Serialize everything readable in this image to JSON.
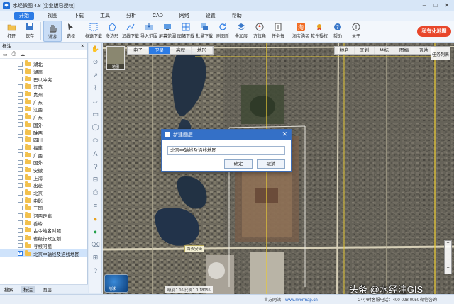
{
  "app": {
    "title": "水经微图 4.8 [企业版已授权]",
    "window_controls": [
      "–",
      "□",
      "✕"
    ]
  },
  "menu": {
    "items": [
      "开始",
      "视图",
      "下载",
      "工具",
      "分析",
      "CAD",
      "网络",
      "设置",
      "帮助"
    ],
    "active": "开始"
  },
  "toolbar": {
    "items": [
      {
        "label": "打开",
        "icon": "folder-open-icon"
      },
      {
        "label": "保存",
        "icon": "save-icon"
      },
      {
        "label": "漫游",
        "icon": "hand-icon"
      },
      {
        "label": "选择",
        "icon": "cursor-icon"
      },
      {
        "label": "框选下载",
        "icon": "frame-select-icon"
      },
      {
        "label": "多边形",
        "icon": "polygon-icon"
      },
      {
        "label": "沿线下载",
        "icon": "polyline-icon"
      },
      {
        "label": "导入范围",
        "icon": "import-icon"
      },
      {
        "label": "屏幕范围",
        "icon": "screen-icon"
      },
      {
        "label": "图幅下载",
        "icon": "grid-icon"
      },
      {
        "label": "批量下载",
        "icon": "batch-icon"
      },
      {
        "label": "刷图新",
        "icon": "refresh-icon"
      },
      {
        "label": "叠加层",
        "icon": "layers-icon"
      },
      {
        "label": "方位角",
        "icon": "compass-icon"
      },
      {
        "label": "任务每",
        "icon": "task-icon"
      },
      {
        "label": "淘宝购买",
        "icon": "taobao-icon"
      },
      {
        "label": "软件授权",
        "icon": "license-icon"
      },
      {
        "label": "帮助",
        "icon": "help-icon"
      },
      {
        "label": "关于",
        "icon": "info-icon"
      }
    ],
    "active": "漫游",
    "private_button": "私有化地图"
  },
  "left_panel": {
    "title": "标注",
    "close": "✕",
    "tree": [
      "湖北",
      "湖南",
      "巴以冲突",
      "江苏",
      "贵州",
      "广东",
      "江西",
      "广东",
      "国外",
      "陕西",
      "四川",
      "福建",
      "广西",
      "国外",
      "安徽",
      "上海",
      "出差",
      "北京",
      "电影",
      "三国",
      "河西走廊",
      "香岭",
      "古今地名对照",
      "省级行政区划",
      "寻根问祖",
      "北京中轴线及沿线地图"
    ],
    "selected": "北京中轴线及沿线地图",
    "tabs": [
      "搜索",
      "标注",
      "图层"
    ],
    "active_tab": "标注"
  },
  "map": {
    "base_tabs": [
      "电子",
      "卫星",
      "高程",
      "地形"
    ],
    "active_base_tab": "卫星",
    "overlay_tabs": [
      "地名",
      "区划",
      "坐标",
      "图幅",
      "瓦片"
    ],
    "thumbnail_label": "地图",
    "task_list": "任务列表",
    "labels": [
      "西长安街",
      "北京中轴线"
    ],
    "road_tags": [
      "西长安街"
    ],
    "globe_label": "地球",
    "scale": "级别：16  比例：1:18055",
    "zoom_plus": "+",
    "zoom_minus": "−"
  },
  "dialog": {
    "title": "新建图层",
    "close": "✕",
    "input_value": "北京中轴线及沿线地图",
    "ok": "确定",
    "cancel": "取消"
  },
  "status": {
    "coords": "经纬度：116.39743, 39.90764",
    "site_label": "官方网站：",
    "site_url": "www.rivermap.cn",
    "phone": "24小时客服电话：400-028-0050",
    "wechat": "微信咨询"
  },
  "watermark": "头条 @水经注GIS",
  "colors": {
    "accent": "#2c7be5",
    "dialog_header": "#3470c7",
    "private_button": "#e8462a",
    "folder": "#f2c14e"
  }
}
